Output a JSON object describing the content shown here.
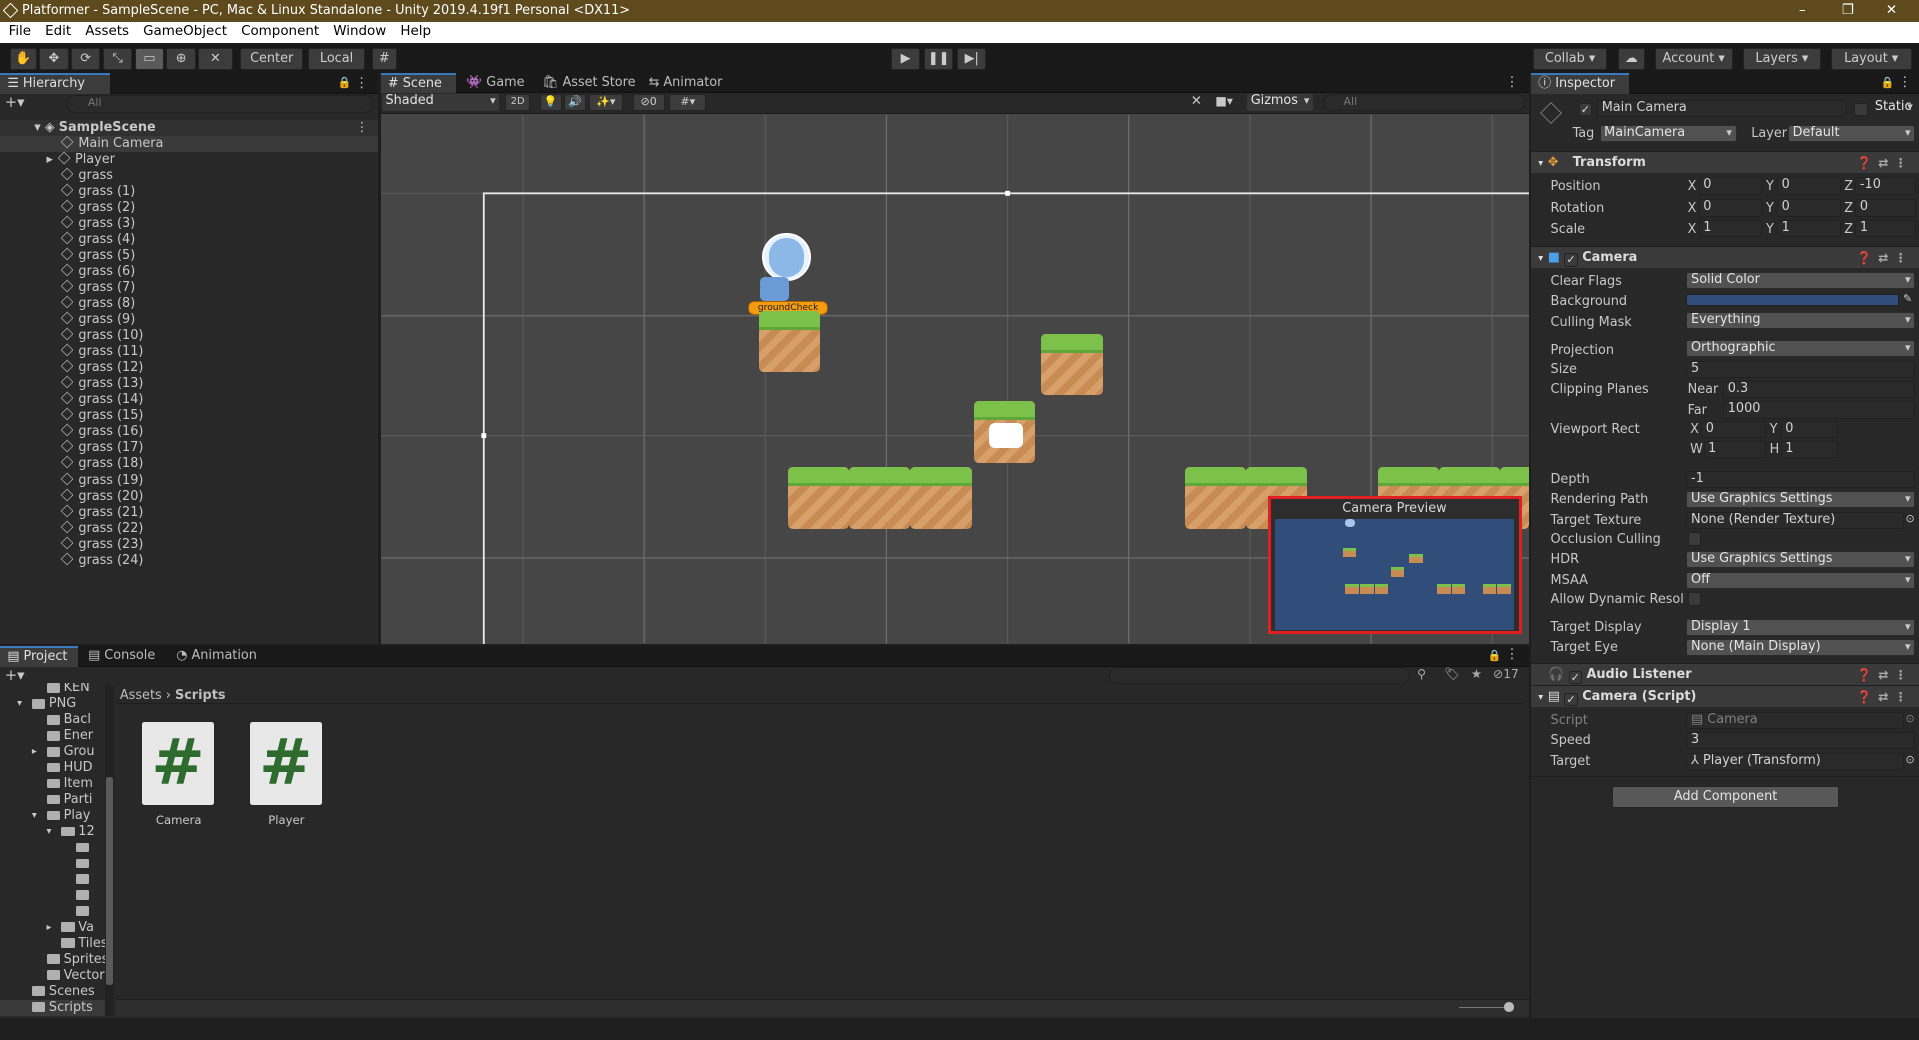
{
  "window": {
    "title": "Platformer - SampleScene - PC, Mac & Linux Standalone - Unity 2019.4.19f1 Personal <DX11>",
    "controls": [
      "–",
      "❐",
      "✕"
    ]
  },
  "menu": [
    "File",
    "Edit",
    "Assets",
    "GameObject",
    "Component",
    "Window",
    "Help"
  ],
  "toolbar": {
    "pivot_mode": "Center",
    "pivot_rotation": "Local",
    "collab": "Collab ▾",
    "account": "Account",
    "layers": "Layers",
    "layout": "Layout"
  },
  "hierarchy": {
    "tab": "Hierarchy",
    "search_placeholder": "All",
    "scene": "SampleScene",
    "items": [
      "Main Camera",
      "Player",
      "grass",
      "grass (1)",
      "grass (2)",
      "grass (3)",
      "grass (4)",
      "grass (5)",
      "grass (6)",
      "grass (7)",
      "grass (8)",
      "grass (9)",
      "grass (10)",
      "grass (11)",
      "grass (12)",
      "grass (13)",
      "grass (14)",
      "grass (15)",
      "grass (16)",
      "grass (17)",
      "grass (18)",
      "grass (19)",
      "grass (20)",
      "grass (21)",
      "grass (22)",
      "grass (23)",
      "grass (24)"
    ]
  },
  "scene_view": {
    "tabs": [
      "Scene",
      "Game",
      "Asset Store",
      "Animator"
    ],
    "shading": "Shaded",
    "mode_2d": "2D",
    "hidden_count": "0",
    "gizmos": "Gizmos",
    "search_placeholder": "All",
    "player_label": "groundCheck",
    "camera_preview_title": "Camera Preview"
  },
  "inspector": {
    "tab": "Inspector",
    "object_name": "Main Camera",
    "static_label": "Static",
    "tag_label": "Tag",
    "tag": "MainCamera",
    "layer_label": "Layer",
    "layer": "Default",
    "transform": {
      "title": "Transform",
      "position_label": "Position",
      "position": {
        "x": "0",
        "y": "0",
        "z": "-10"
      },
      "rotation_label": "Rotation",
      "rotation": {
        "x": "0",
        "y": "0",
        "z": "0"
      },
      "scale_label": "Scale",
      "scale": {
        "x": "1",
        "y": "1",
        "z": "1"
      }
    },
    "camera": {
      "title": "Camera",
      "clear_flags_label": "Clear Flags",
      "clear_flags": "Solid Color",
      "background_label": "Background",
      "background_color": "#314d79",
      "culling_mask_label": "Culling Mask",
      "culling_mask": "Everything",
      "projection_label": "Projection",
      "projection": "Orthographic",
      "size_label": "Size",
      "size": "5",
      "clipping_label": "Clipping Planes",
      "near_label": "Near",
      "near": "0.3",
      "far_label": "Far",
      "far": "1000",
      "viewport_label": "Viewport Rect",
      "vx": "0",
      "vy": "0",
      "vw": "1",
      "vh": "1",
      "depth_label": "Depth",
      "depth": "-1",
      "rendering_path_label": "Rendering Path",
      "rendering_path": "Use Graphics Settings",
      "target_texture_label": "Target Texture",
      "target_texture": "None (Render Texture)",
      "occlusion_label": "Occlusion Culling",
      "hdr_label": "HDR",
      "hdr": "Use Graphics Settings",
      "msaa_label": "MSAA",
      "msaa": "Off",
      "dynamic_res_label": "Allow Dynamic Resoluti",
      "target_display_label": "Target Display",
      "target_display": "Display 1",
      "target_eye_label": "Target Eye",
      "target_eye": "None (Main Display)"
    },
    "audio_listener": {
      "title": "Audio Listener"
    },
    "camera_script": {
      "title": "Camera (Script)",
      "script_label": "Script",
      "script": "Camera",
      "speed_label": "Speed",
      "speed": "3",
      "target_label": "Target",
      "target": "Player (Transform)"
    },
    "add_component": "Add Component"
  },
  "project": {
    "tabs": [
      "Project",
      "Console",
      "Animation"
    ],
    "breadcrumb": [
      "Assets",
      "Scripts"
    ],
    "hidden_count": "17",
    "tree": [
      "KEN",
      "PNG",
      "Bacl",
      "Ener",
      "Grou",
      "HUD",
      "Item",
      "Parti",
      "Play",
      "12",
      "Va",
      "Tiles",
      "Sprites",
      "Vector",
      "Scenes",
      "Scripts"
    ],
    "assets": [
      "Camera",
      "Player"
    ]
  }
}
